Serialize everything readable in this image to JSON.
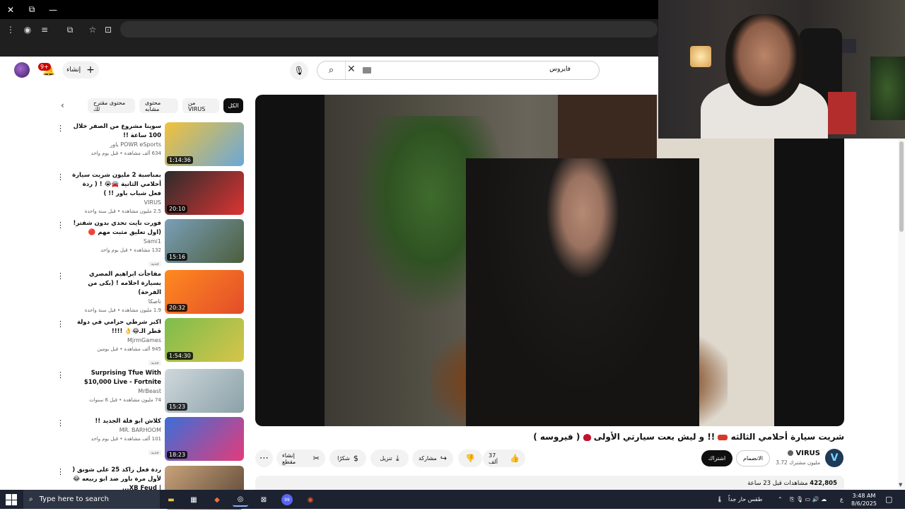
{
  "browser": {
    "window_controls": {
      "close": "✕",
      "restore": "⧉",
      "minimize": "—"
    }
  },
  "header": {
    "notification_count": "9+",
    "create_label": "إنشاء",
    "search_value": "فايروس"
  },
  "chips": [
    {
      "label": "الكل"
    },
    {
      "label": "من VIRUS"
    },
    {
      "label": "محتوى مشابه"
    },
    {
      "label": "محتوى مقترح لك"
    }
  ],
  "related": [
    {
      "title": "سوينا مشروع من الصفر خلال 100 ساعة !!",
      "channel": "POWR eSports باور",
      "stats": "634 ألف مشاهدة • قبل يوم واحد",
      "badge": "",
      "duration": "1:14:36",
      "colors": [
        "#f2c23a",
        "#6aa8d8"
      ]
    },
    {
      "title": "بمناسبة 2 مليون شريت سيارة أحلامي الثانية 🚘😭 ! ( ردة فعل شباب باور !! )",
      "channel": "VIRUS",
      "stats": "2.5 مليون مشاهدة • قبل سنة واحدة",
      "badge": "",
      "duration": "20:10",
      "colors": [
        "#2c2c2c",
        "#d33"
      ]
    },
    {
      "title": "فورت نايت تحدي بدون شفتر! (اول تعليق مثبت مهم 🔴",
      "channel": "Sami1",
      "stats": "132 مشاهدة • قبل يوم واحد",
      "badge": "جديد",
      "duration": "15:16",
      "colors": [
        "#7a9fb8",
        "#4b5e3c"
      ]
    },
    {
      "title": "مفاجأت ابراهيم المصري بسيارة احلامه ! (بكى من الفرحة)",
      "channel": "ناصكا",
      "stats": "1.9 مليون مشاهدة • قبل سنة واحدة",
      "badge": "",
      "duration": "20:32",
      "colors": [
        "#ff8a1f",
        "#e24d2a"
      ]
    },
    {
      "title": "اكبر شرطي حرامي في دولة قطر الـ😂👌 !!!!",
      "channel": "MjrmGames",
      "stats": "945 ألف مشاهدة • قبل يومين",
      "badge": "جديد",
      "duration": "1:54:30",
      "colors": [
        "#7bbd4c",
        "#d8c44a"
      ]
    },
    {
      "title": "Surprising Tfue With $10,000 Live - Fortnite",
      "channel": "MrBeast",
      "stats": "74 مليون مشاهدة • قبل 6 سنوات",
      "badge": "",
      "duration": "15:23",
      "colors": [
        "#cfd8dc",
        "#8aa1a8"
      ]
    },
    {
      "title": "كلاش ابو فلة الجديد !!",
      "channel": "MR. BARHOOM",
      "stats": "101 ألف مشاهدة • قبل يوم واحد",
      "badge": "جديد",
      "duration": "18:23",
      "colors": [
        "#3a6fd8",
        "#e43b7a"
      ]
    },
    {
      "title": "ردة فعل راكد 25 على شونق ( لأول مرة باور ضد ابو ربيعه 😂 | XB Feud...",
      "channel": "",
      "stats": "",
      "badge": "",
      "duration": "",
      "colors": [
        "#c8a37a",
        "#5a4535"
      ]
    }
  ],
  "video": {
    "title_prefix": "شريت سيارة أحلامي الثالثه",
    "title_mid": "!! و ليش بعت سيارتي الأولى",
    "title_suffix": "( فيروسه )",
    "channel": "VIRUS",
    "channel_initial": "V",
    "subscribers": "3.72 مليون مشترك",
    "join_label": "الانضمام",
    "subscribe_label": "اشتراك",
    "likes": "37 ألف",
    "share_label": "مشاركة",
    "download_label": "تنزيل",
    "thanks_label": "شكرًا",
    "clip_label": "إنشاء مقطع",
    "views": "422,805",
    "views_suffix": "مشاهدات قبل 23 ساعة"
  },
  "taskbar": {
    "search_placeholder": "Type here to search",
    "weather": "طقس حار جداً",
    "lang": "ع",
    "time": "3:48 AM",
    "date": "8/6/2025",
    "badge_count": "99"
  }
}
